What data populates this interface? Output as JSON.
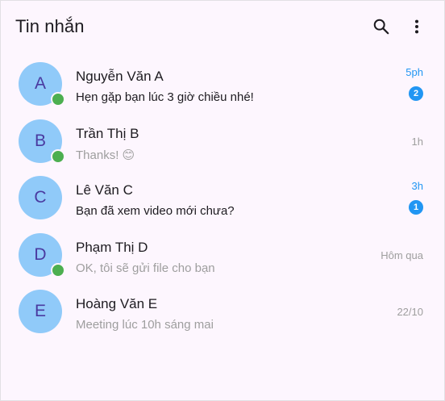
{
  "app_bar": {
    "title": "Tin nhắn",
    "search_icon": "search-icon",
    "menu_icon": "more-vert-icon"
  },
  "colors": {
    "background": "#fdf6fe",
    "avatar": "#90caf9",
    "avatar_text": "#4a3aa0",
    "online": "#4caf50",
    "accent": "#2196f3",
    "muted": "#9e9e9e"
  },
  "conversations": [
    {
      "initial": "A",
      "name": "Nguyễn Văn A",
      "message": "Hẹn gặp bạn lúc 3 giờ chiều nhé!",
      "time": "5ph",
      "unread": "2",
      "online": true
    },
    {
      "initial": "B",
      "name": "Trần Thị B",
      "message": "Thanks! 😊",
      "time": "1h",
      "unread": "",
      "online": true
    },
    {
      "initial": "C",
      "name": "Lê Văn C",
      "message": "Bạn đã xem video mới chưa?",
      "time": "3h",
      "unread": "1",
      "online": false
    },
    {
      "initial": "D",
      "name": "Phạm Thị D",
      "message": "OK, tôi sẽ gửi file cho bạn",
      "time": "Hôm qua",
      "unread": "",
      "online": true
    },
    {
      "initial": "E",
      "name": "Hoàng Văn E",
      "message": "Meeting lúc 10h sáng mai",
      "time": "22/10",
      "unread": "",
      "online": false
    }
  ]
}
